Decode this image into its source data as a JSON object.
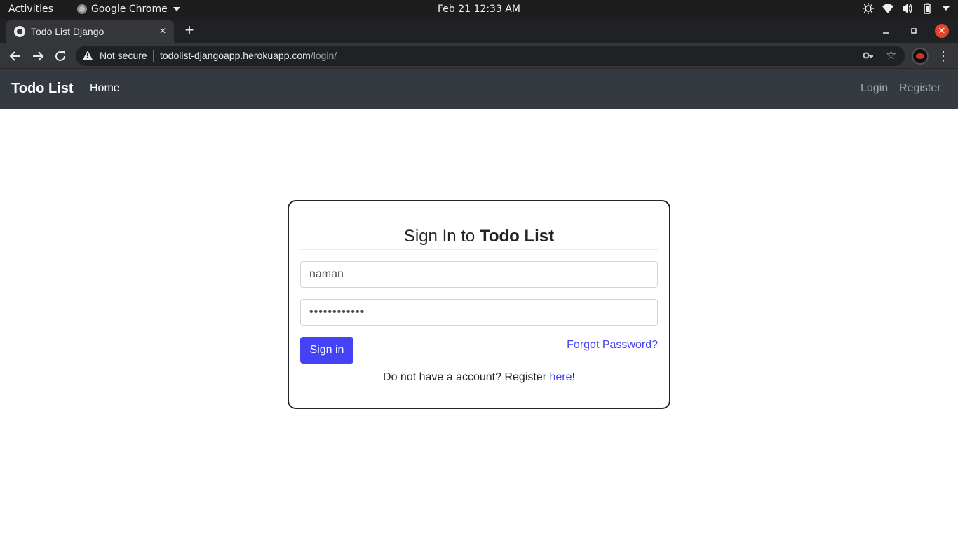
{
  "os_bar": {
    "activities": "Activities",
    "app_name": "Google Chrome",
    "clock": "Feb 21  12:33 AM"
  },
  "browser": {
    "tab_title": "Todo List Django",
    "tab_close": "×",
    "new_tab": "+",
    "security_label": "Not secure",
    "url_host": "todolist-djangoapp.herokuapp.com",
    "url_path": "/login/"
  },
  "navbar": {
    "brand": "Todo List",
    "home": "Home",
    "login": "Login",
    "register": "Register"
  },
  "login_card": {
    "title_prefix": "Sign In to ",
    "title_bold": "Todo List",
    "username_value": "naman",
    "password_value": "••••••••••••",
    "signin_label": "Sign in",
    "forgot_label": "Forgot Password?",
    "footer_prefix": "Do not have a account? Register ",
    "footer_link": "here",
    "footer_suffix": "!"
  },
  "colors": {
    "accent": "#4343f5",
    "navbar_bg": "#343a40",
    "os_bar_bg": "#1d1d1d",
    "close_button": "#e0452b"
  },
  "icons": [
    "app-icon",
    "brightness-icon",
    "wifi-icon",
    "volume-icon",
    "battery-icon",
    "globe-favicon",
    "back-icon",
    "forward-icon",
    "reload-icon",
    "warning-icon",
    "key-icon",
    "star-icon",
    "profile-avatar",
    "menu-kebab-icon",
    "minimize-icon",
    "maximize-icon",
    "close-icon"
  ]
}
